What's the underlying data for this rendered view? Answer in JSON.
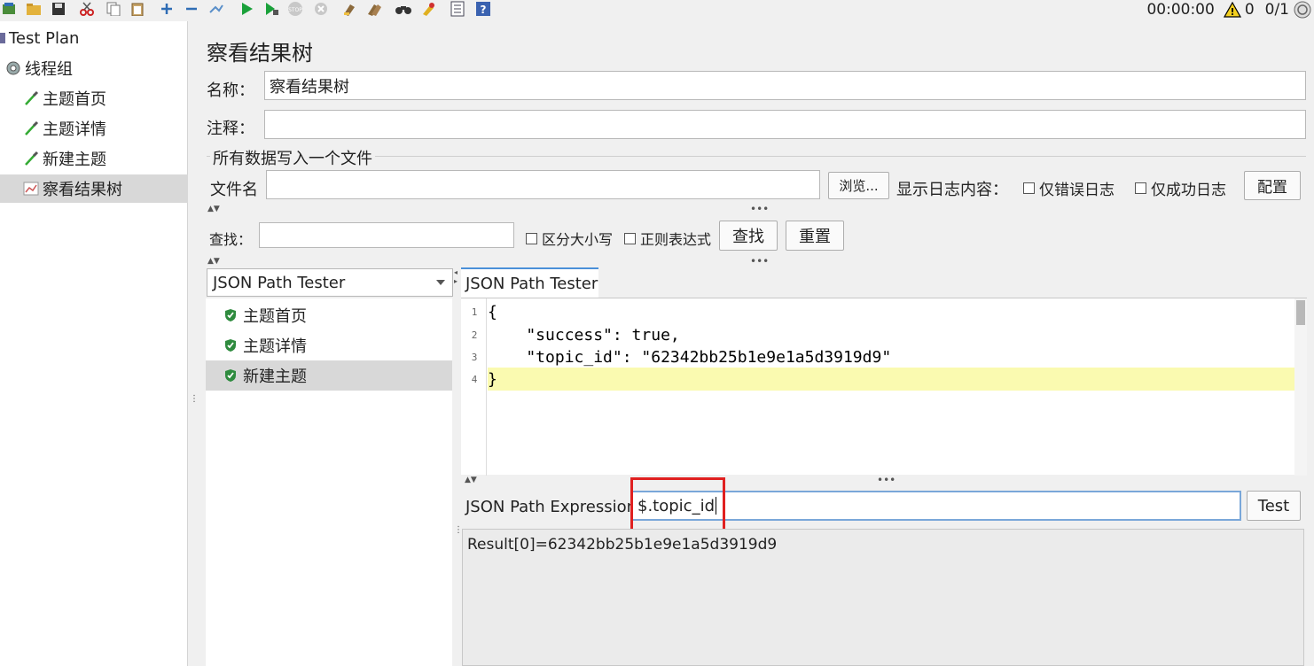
{
  "toolbar": {
    "icons": [
      "templates-icon",
      "open-icon",
      "save-icon",
      "cut-icon",
      "copy-icon",
      "paste-icon",
      "expand-icon",
      "collapse-icon",
      "toggle-icon",
      "start-icon",
      "start-no-pause-icon",
      "stop-icon",
      "shutdown-icon",
      "clear-icon",
      "clear-all-icon",
      "search-icon",
      "reset-search-icon",
      "function-helper-icon",
      "help-icon"
    ],
    "timer": "00:00:00",
    "warning_count": "0",
    "threads": "0/1"
  },
  "tree": {
    "items": [
      {
        "label": "Test Plan",
        "icon": "test-plan-icon"
      },
      {
        "label": "线程组",
        "icon": "gear-icon"
      },
      {
        "label": "主题首页",
        "icon": "pipette-icon"
      },
      {
        "label": "主题详情",
        "icon": "pipette-icon"
      },
      {
        "label": "新建主题",
        "icon": "pipette-icon"
      },
      {
        "label": "察看结果树",
        "icon": "graph-icon"
      }
    ]
  },
  "panel": {
    "title": "察看结果树",
    "name_label": "名称：",
    "name_value": "察看结果树",
    "comment_label": "注释：",
    "comment_value": "",
    "file_section": "所有数据写入一个文件",
    "filename_label": "文件名",
    "filename_value": "",
    "browse_button": "浏览...",
    "log_label": "显示日志内容：",
    "errors_only": "仅错误日志",
    "success_only": "仅成功日志",
    "configure_button": "配置",
    "search_label": "查找：",
    "search_value": "",
    "case_sensitive": "区分大小写",
    "regex": "正则表达式",
    "find_button": "查找",
    "reset_button": "重置"
  },
  "renderer": {
    "selected": "JSON Path Tester",
    "samples": [
      "主题首页",
      "主题详情",
      "新建主题"
    ]
  },
  "tester": {
    "tab": "JSON Path Tester",
    "code_lines": [
      {
        "n": "1",
        "text": "{"
      },
      {
        "n": "2",
        "text": "    \"success\": true,"
      },
      {
        "n": "3",
        "text": "    \"topic_id\": \"62342bb25b1e9e1a5d3919d9\""
      },
      {
        "n": "4",
        "text": "}"
      }
    ],
    "expression_label": "JSON Path Expression",
    "expression_value": "$.topic_id",
    "test_button": "Test",
    "result": "Result[0]=62342bb25b1e9e1a5d3919d9"
  },
  "colors": {
    "highlight_line": "#fafab0",
    "annotation_box": "#e02020",
    "shield_green": "#2e8b3e"
  }
}
